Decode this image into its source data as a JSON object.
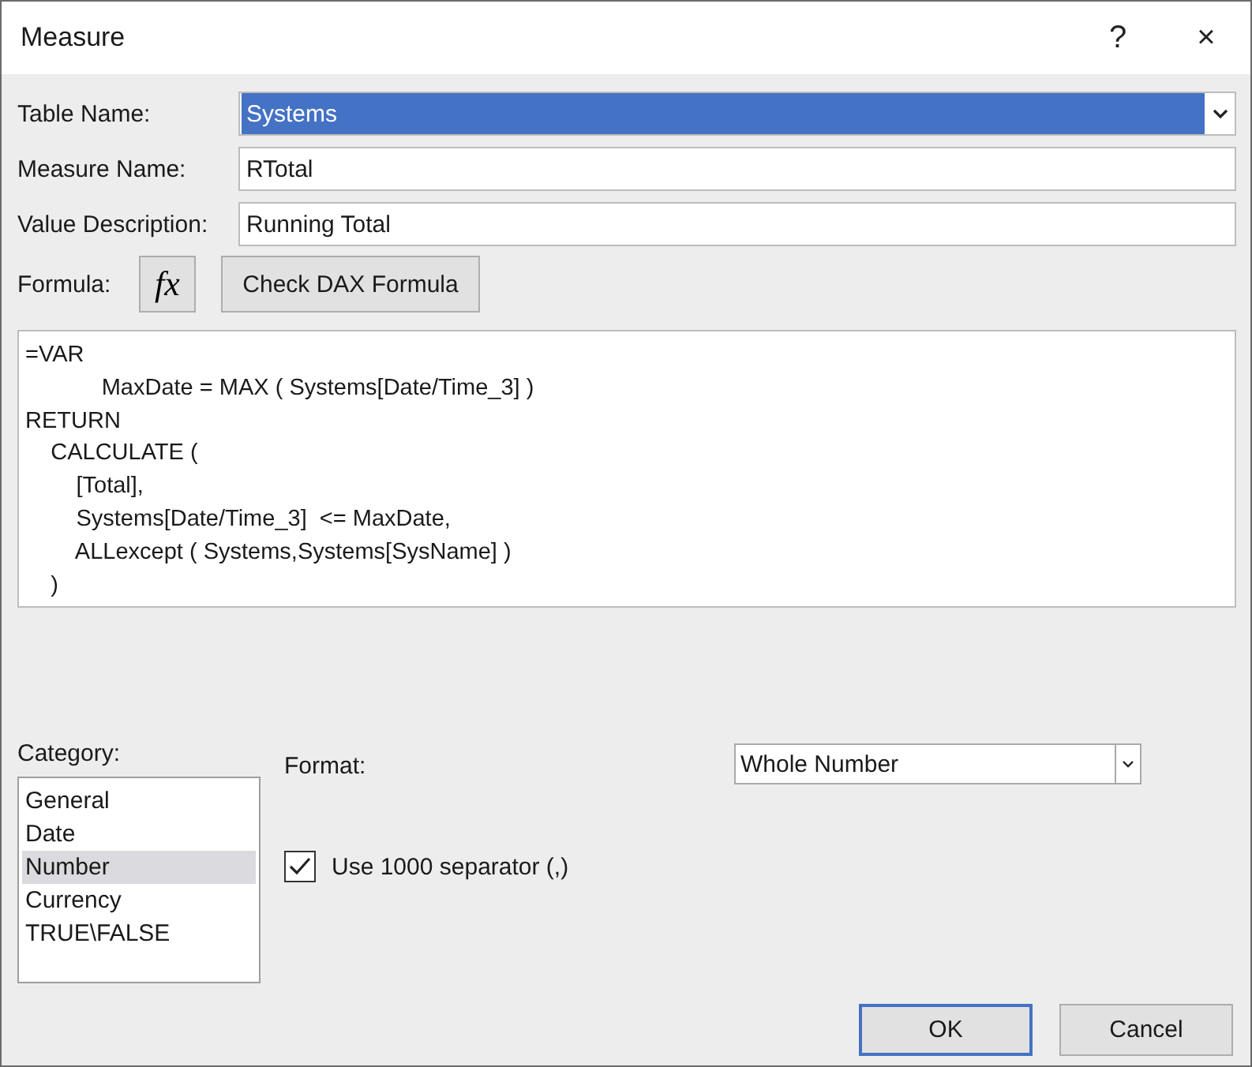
{
  "window": {
    "title": "Measure",
    "help": "?",
    "close": "×"
  },
  "table_name": {
    "label": "Table Name:",
    "value": "Systems"
  },
  "measure_name": {
    "label": "Measure Name:",
    "value": "RTotal"
  },
  "value_description": {
    "label": "Value Description:",
    "value": "Running Total"
  },
  "formula": {
    "label": "Formula:",
    "fx": "fx",
    "check_button": "Check DAX Formula",
    "lines": [
      "=VAR",
      "            MaxDate = MAX ( Systems[Date/Time_3] )",
      "RETURN",
      "    CALCULATE (",
      "        [Total],",
      "        Systems[Date/Time_3]  <= MaxDate,",
      "        ALLexcept ( Systems,Systems[SysName] )",
      "    )"
    ]
  },
  "category": {
    "label": "Category:",
    "items": [
      {
        "label": "General",
        "selected": false
      },
      {
        "label": "Date",
        "selected": false
      },
      {
        "label": "Number",
        "selected": true
      },
      {
        "label": "Currency",
        "selected": false
      },
      {
        "label": "TRUE\\FALSE",
        "selected": false
      }
    ]
  },
  "format": {
    "label": "Format:",
    "value": "Whole Number"
  },
  "separator": {
    "label": "Use 1000 separator (,)",
    "checked": true
  },
  "buttons": [
    {
      "label": "OK",
      "default": true
    },
    {
      "label": "Cancel",
      "default": false
    }
  ]
}
